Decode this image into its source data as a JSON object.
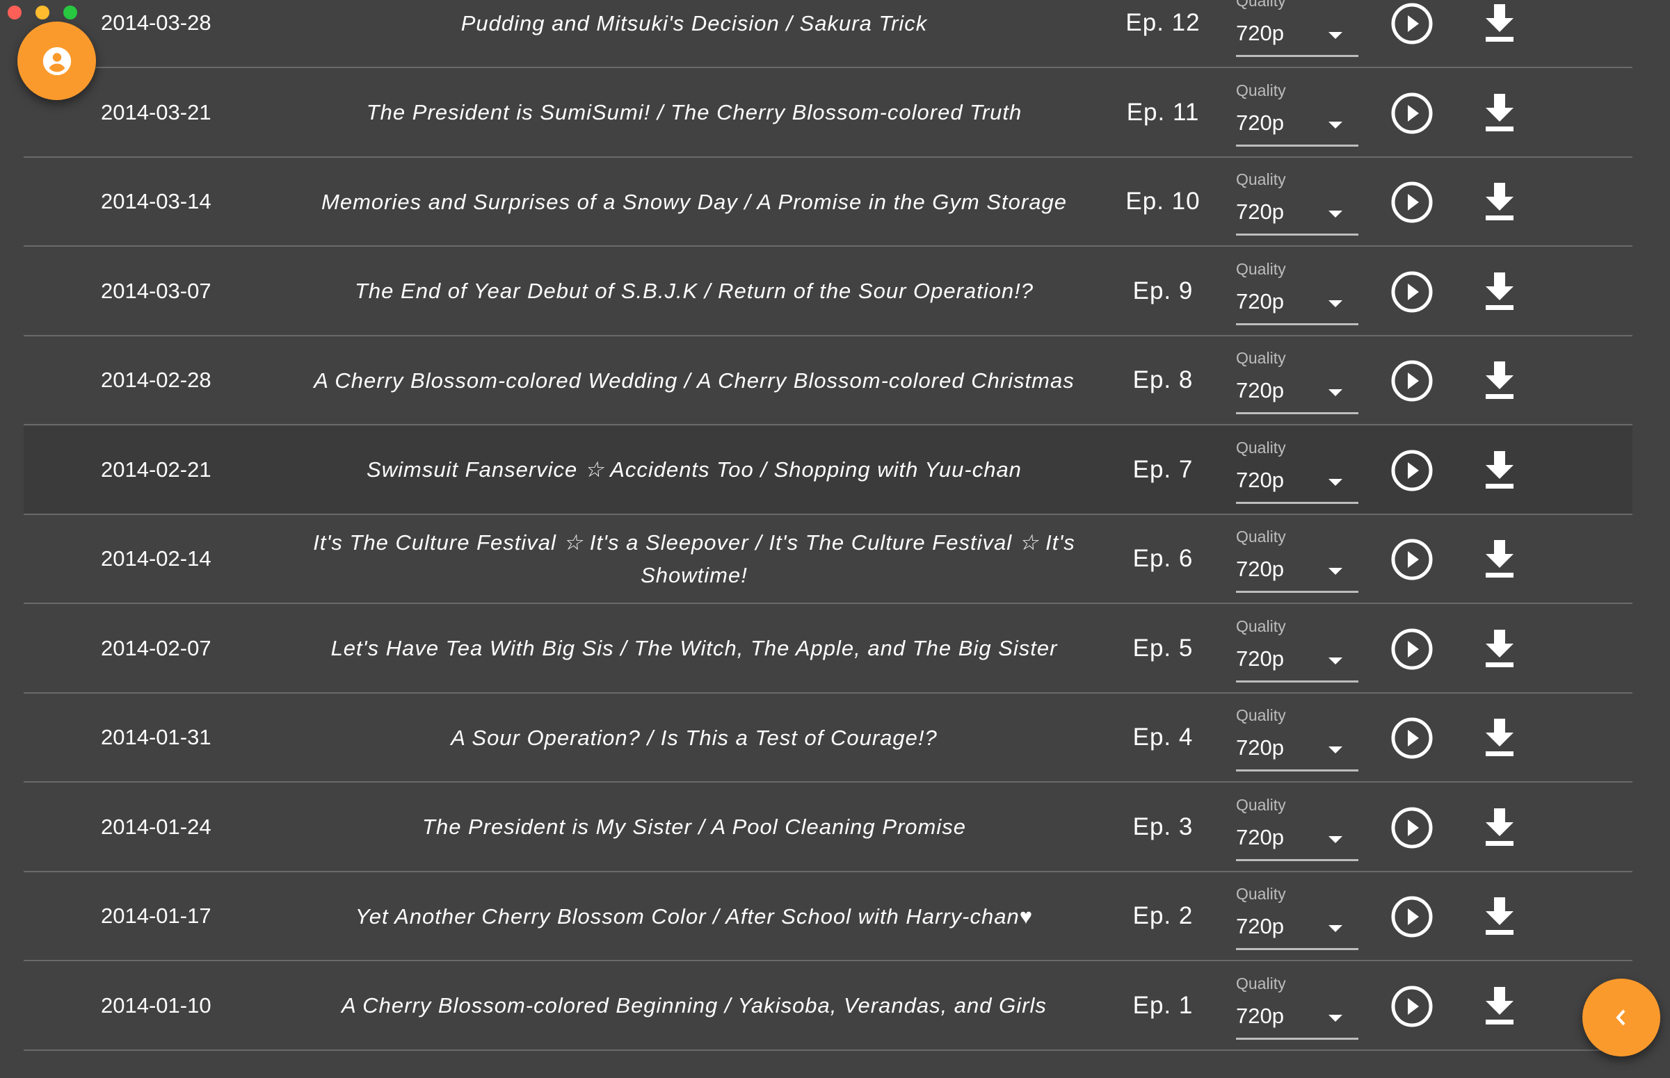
{
  "colors": {
    "background": "#424242",
    "accent": "#fb9a2c",
    "close": "#fe5f57",
    "minimize": "#febc2e",
    "zoom": "#28c840"
  },
  "quality_label": "Quality",
  "episodes": [
    {
      "date": "2014-03-28",
      "title": "Pudding and Mitsuki's Decision / Sakura Trick",
      "ep": "Ep. 12",
      "quality": "720p"
    },
    {
      "date": "2014-03-21",
      "title": "The President is SumiSumi! / The Cherry Blossom-colored Truth",
      "ep": "Ep. 11",
      "quality": "720p"
    },
    {
      "date": "2014-03-14",
      "title": "Memories and Surprises of a Snowy Day / A Promise in the Gym Storage",
      "ep": "Ep. 10",
      "quality": "720p"
    },
    {
      "date": "2014-03-07",
      "title": "The End of Year Debut of S.B.J.K / Return of the Sour Operation!?",
      "ep": "Ep. 9",
      "quality": "720p"
    },
    {
      "date": "2014-02-28",
      "title": "A Cherry Blossom-colored Wedding / A Cherry Blossom-colored Christmas",
      "ep": "Ep. 8",
      "quality": "720p"
    },
    {
      "date": "2014-02-21",
      "title": "Swimsuit Fanservice ☆ Accidents Too / Shopping with Yuu-chan",
      "ep": "Ep. 7",
      "quality": "720p",
      "hover": true
    },
    {
      "date": "2014-02-14",
      "title": "It's The Culture Festival ☆ It's a Sleepover / It's The Culture Festival ☆ It's Showtime!",
      "ep": "Ep. 6",
      "quality": "720p"
    },
    {
      "date": "2014-02-07",
      "title": "Let's Have Tea With Big Sis / The Witch, The Apple, and The Big Sister",
      "ep": "Ep. 5",
      "quality": "720p"
    },
    {
      "date": "2014-01-31",
      "title": "A Sour Operation? / Is This a Test of Courage!?",
      "ep": "Ep. 4",
      "quality": "720p"
    },
    {
      "date": "2014-01-24",
      "title": "The President is My Sister / A Pool Cleaning Promise",
      "ep": "Ep. 3",
      "quality": "720p"
    },
    {
      "date": "2014-01-17",
      "title": "Yet Another Cherry Blossom Color / After School with Harry-chan♥",
      "ep": "Ep. 2",
      "quality": "720p"
    },
    {
      "date": "2014-01-10",
      "title": "A Cherry Blossom-colored Beginning / Yakisoba, Verandas, and Girls",
      "ep": "Ep. 1",
      "quality": "720p"
    }
  ]
}
